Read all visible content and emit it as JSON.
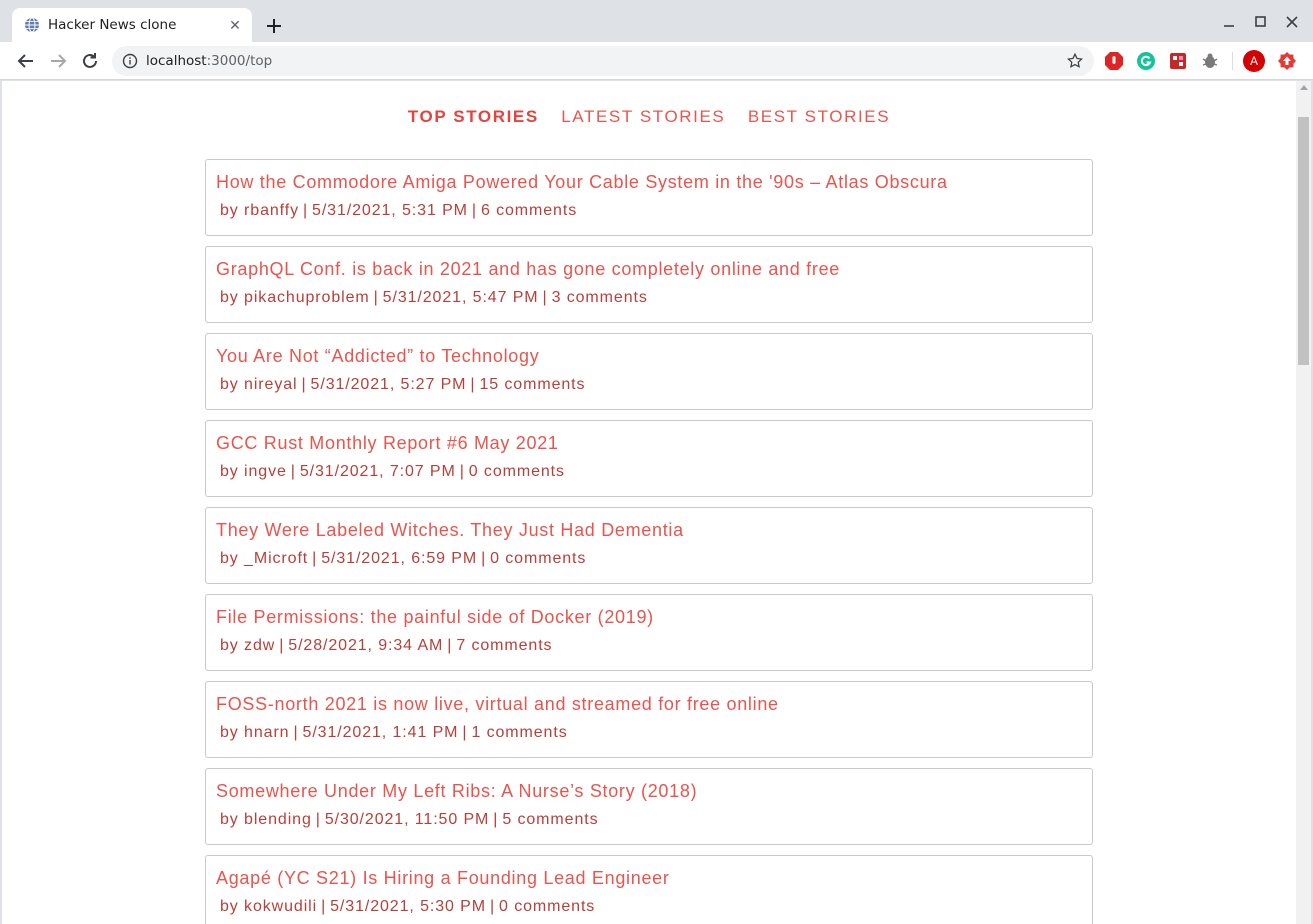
{
  "browser": {
    "tab_title": "Hacker News clone",
    "url_host": "localhost",
    "url_path": ":3000/top",
    "profile_initial": "A"
  },
  "nav": {
    "items": [
      {
        "label": "TOP STORIES",
        "active": true
      },
      {
        "label": "LATEST STORIES",
        "active": false
      },
      {
        "label": "BEST STORIES",
        "active": false
      }
    ]
  },
  "stories": [
    {
      "title": "How the Commodore Amiga Powered Your Cable System in the '90s – Atlas Obscura",
      "by": "by rbanffy",
      "time": "5/31/2021, 5:31 PM",
      "comments": "6 comments"
    },
    {
      "title": "GraphQL Conf. is back in 2021 and has gone completely online and free",
      "by": "by pikachuproblem",
      "time": "5/31/2021, 5:47 PM",
      "comments": "3 comments"
    },
    {
      "title": "You Are Not “Addicted” to Technology",
      "by": "by nireyal",
      "time": "5/31/2021, 5:27 PM",
      "comments": "15 comments"
    },
    {
      "title": "GCC Rust Monthly Report #6 May 2021",
      "by": "by ingve",
      "time": "5/31/2021, 7:07 PM",
      "comments": "0 comments"
    },
    {
      "title": "They Were Labeled Witches. They Just Had Dementia",
      "by": "by _Microft",
      "time": "5/31/2021, 6:59 PM",
      "comments": "0 comments"
    },
    {
      "title": "File Permissions: the painful side of Docker (2019)",
      "by": "by zdw",
      "time": "5/28/2021, 9:34 AM",
      "comments": "7 comments"
    },
    {
      "title": "FOSS-north 2021 is now live, virtual and streamed for free online",
      "by": "by hnarn",
      "time": "5/31/2021, 1:41 PM",
      "comments": "1 comments"
    },
    {
      "title": "Somewhere Under My Left Ribs: A Nurse’s Story (2018)",
      "by": "by blending",
      "time": "5/30/2021, 11:50 PM",
      "comments": "5 comments"
    },
    {
      "title": "Agapé (YC S21) Is Hiring a Founding Lead Engineer",
      "by": "by kokwudili",
      "time": "5/31/2021, 5:30 PM",
      "comments": "0 comments"
    }
  ]
}
